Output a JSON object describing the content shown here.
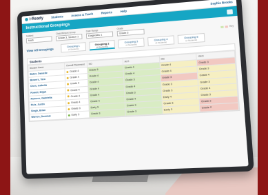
{
  "topnav": {
    "logo": "i-Ready",
    "items": [
      "Students",
      "Assess & Teach",
      "Reports",
      "Help"
    ],
    "user": "Sophia Brooks"
  },
  "banner": {
    "title": "Instructional Groupings"
  },
  "filters": [
    {
      "label": "Subject",
      "value": "Math"
    },
    {
      "label": "Class/Report Group",
      "value": "Grade 3, Section 1"
    },
    {
      "label": "Date Range",
      "value": "Diagnostic 1"
    },
    {
      "label": "Grade",
      "value": "Grade 3"
    }
  ],
  "legend": "Key",
  "groups": {
    "view_all": "View All Groupings",
    "tabs": [
      {
        "label": "Grouping 1",
        "sub": "(4 Students)"
      },
      {
        "label": "Grouping 2",
        "sub": "(4 Students)"
      },
      {
        "label": "Grouping 3",
        "sub": "(4 Students)"
      },
      {
        "label": "Grouping 4",
        "sub": "(4 Students)"
      },
      {
        "label": "Grouping 5",
        "sub": "(4 Students)"
      }
    ]
  },
  "students_panel": {
    "title": "Students",
    "columns": [
      "Student Name",
      "Overall Placement",
      "NO",
      "ALG",
      "MS",
      "GEO"
    ],
    "rows": [
      {
        "name": "Baker, Danielle",
        "place": "Grade 4",
        "dot": "#e5b52a",
        "c": [
          [
            "Grade 5",
            "g"
          ],
          [
            "Grade 4",
            "g"
          ],
          [
            "Grade 4",
            "y"
          ],
          [
            "Grade 3",
            "r"
          ]
        ]
      },
      {
        "name": "Bowers, Tara",
        "place": "Grade 4",
        "dot": "#e5b52a",
        "c": [
          [
            "Grade 4",
            "g"
          ],
          [
            "Grade 4",
            "g"
          ],
          [
            "Grade 4",
            "y"
          ],
          [
            "Grade 3",
            "y"
          ]
        ]
      },
      {
        "name": "Chen, Isabella",
        "place": "Grade 4",
        "dot": "#e5b52a",
        "c": [
          [
            "Grade 4",
            "g"
          ],
          [
            "Grade 3",
            "g"
          ],
          [
            "Grade 3",
            "r"
          ],
          [
            "Grade 4",
            "y"
          ]
        ]
      },
      {
        "name": "Powell, Elijah",
        "place": "Grade 4",
        "dot": "#e5b52a",
        "c": [
          [
            "Grade 4",
            "g"
          ],
          [
            "Grade 4",
            "g"
          ],
          [
            "Grade 3",
            "y"
          ],
          [
            "Grade 3",
            "y"
          ]
        ]
      },
      {
        "name": "Romero, Gabriella",
        "place": "Grade 4",
        "dot": "#e5b52a",
        "c": [
          [
            "Grade 4",
            "g"
          ],
          [
            "Grade 3",
            "g"
          ],
          [
            "Grade 3",
            "y"
          ],
          [
            "Grade 4",
            "y"
          ]
        ]
      },
      {
        "name": "Ruiz, Justin",
        "place": "Grade 4",
        "dot": "#e5b52a",
        "c": [
          [
            "Grade 4",
            "g"
          ],
          [
            "Grade 4",
            "g"
          ],
          [
            "Early 4",
            "y"
          ],
          [
            "Grade 3",
            "y"
          ]
        ]
      },
      {
        "name": "Singh, Brian",
        "place": "Grade 3",
        "dot": "#e5b52a",
        "c": [
          [
            "Early 5",
            "g"
          ],
          [
            "Grade 3",
            "g"
          ],
          [
            "Grade 3",
            "y"
          ],
          [
            "Grade 2",
            "r"
          ]
        ]
      },
      {
        "name": "Warren, Dominic",
        "place": "Early 3",
        "dot": "#7ab648",
        "c": [
          [
            "Grade 3",
            "g"
          ],
          [
            "Grade 3",
            "g"
          ],
          [
            "Early 3",
            "y"
          ],
          [
            "Grade 2",
            "r"
          ]
        ]
      }
    ]
  }
}
